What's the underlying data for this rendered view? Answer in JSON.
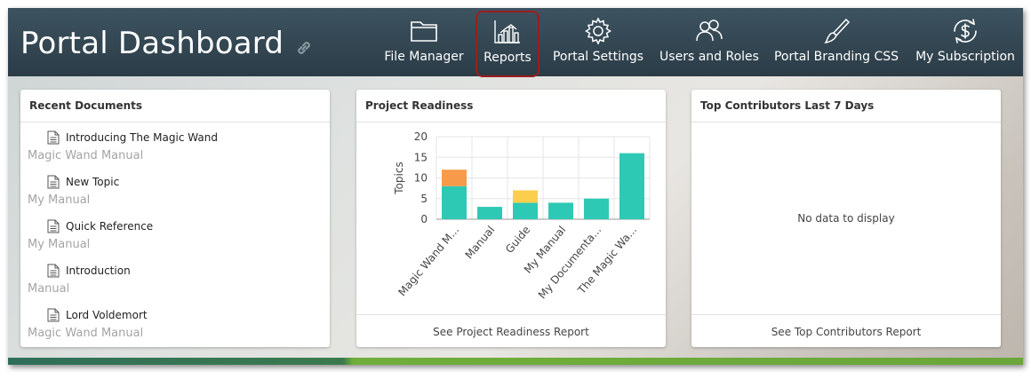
{
  "header": {
    "title": "Portal Dashboard",
    "nav": [
      {
        "label": "File Manager",
        "icon": "folder-icon",
        "active": false
      },
      {
        "label": "Reports",
        "icon": "bar-chart-icon",
        "active": true
      },
      {
        "label": "Portal Settings",
        "icon": "gear-icon",
        "active": false
      },
      {
        "label": "Users and Roles",
        "icon": "users-icon",
        "active": false
      },
      {
        "label": "Portal Branding CSS",
        "icon": "brush-icon",
        "active": false
      },
      {
        "label": "My Subscription",
        "icon": "dollar-refresh-icon",
        "active": false
      }
    ]
  },
  "recent_documents": {
    "title": "Recent Documents",
    "items": [
      {
        "title": "Introducing The Magic Wand",
        "project": "Magic Wand Manual"
      },
      {
        "title": "New Topic",
        "project": "My Manual"
      },
      {
        "title": "Quick Reference",
        "project": "My Manual"
      },
      {
        "title": "Introduction",
        "project": "Manual"
      },
      {
        "title": "Lord Voldemort",
        "project": "Magic Wand Manual"
      }
    ]
  },
  "project_readiness": {
    "title": "Project Readiness",
    "footer": "See Project Readiness Report"
  },
  "top_contributors": {
    "title": "Top Contributors Last 7 Days",
    "empty": "No data to display",
    "footer": "See Top Contributors Report"
  },
  "colors": {
    "teal": "#2ec9b5",
    "orange": "#f79a4a",
    "yellow": "#fbcf4d",
    "active_border": "#9b1d1f"
  },
  "chart_data": {
    "type": "bar",
    "stacked": true,
    "categories": [
      "Magic Wand M...",
      "Manual",
      "Guide",
      "My Manual",
      "My Documenta...",
      "The Magic Wa..."
    ],
    "series": [
      {
        "values": [
          8,
          3,
          4,
          4,
          5,
          16
        ],
        "color": "#2ec9b5"
      },
      {
        "values": [
          4,
          0,
          0,
          0,
          0,
          0
        ],
        "color": "#f79a4a"
      },
      {
        "values": [
          0,
          0,
          3,
          0,
          0,
          0
        ],
        "color": "#fbcf4d"
      }
    ],
    "ylabel": "Topics",
    "ylim": [
      0,
      20
    ],
    "yticks": [
      0,
      5,
      10,
      15,
      20
    ],
    "grid": true
  }
}
